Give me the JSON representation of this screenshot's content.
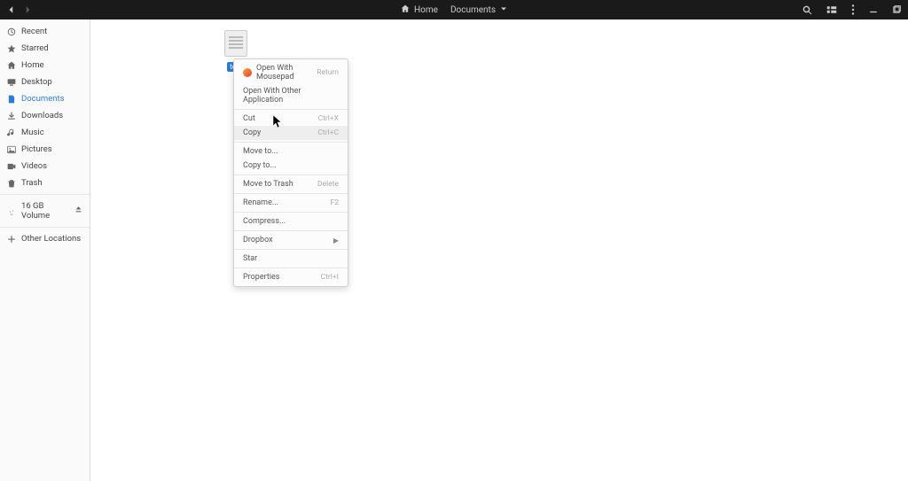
{
  "header": {
    "breadcrumb1": "Home",
    "breadcrumb2": "Documents"
  },
  "sidebar": {
    "items": [
      {
        "label": "Recent"
      },
      {
        "label": "Starred"
      },
      {
        "label": "Home"
      },
      {
        "label": "Desktop"
      },
      {
        "label": "Documents"
      },
      {
        "label": "Downloads"
      },
      {
        "label": "Music"
      },
      {
        "label": "Pictures"
      },
      {
        "label": "Videos"
      },
      {
        "label": "Trash"
      }
    ],
    "volume": "16 GB Volume",
    "other": "Other Locations"
  },
  "file": {
    "label": "test"
  },
  "context_menu": {
    "open_with_app": "Open With Mousepad",
    "open_with_app_shortcut": "Return",
    "open_with_other": "Open With Other Application",
    "cut": "Cut",
    "cut_shortcut": "Ctrl+X",
    "copy": "Copy",
    "copy_shortcut": "Ctrl+C",
    "move_to": "Move to...",
    "copy_to": "Copy to...",
    "move_to_trash": "Move to Trash",
    "move_to_trash_shortcut": "Delete",
    "rename": "Rename...",
    "rename_shortcut": "F2",
    "compress": "Compress...",
    "dropbox": "Dropbox",
    "star": "Star",
    "properties": "Properties",
    "properties_shortcut": "Ctrl+I"
  }
}
